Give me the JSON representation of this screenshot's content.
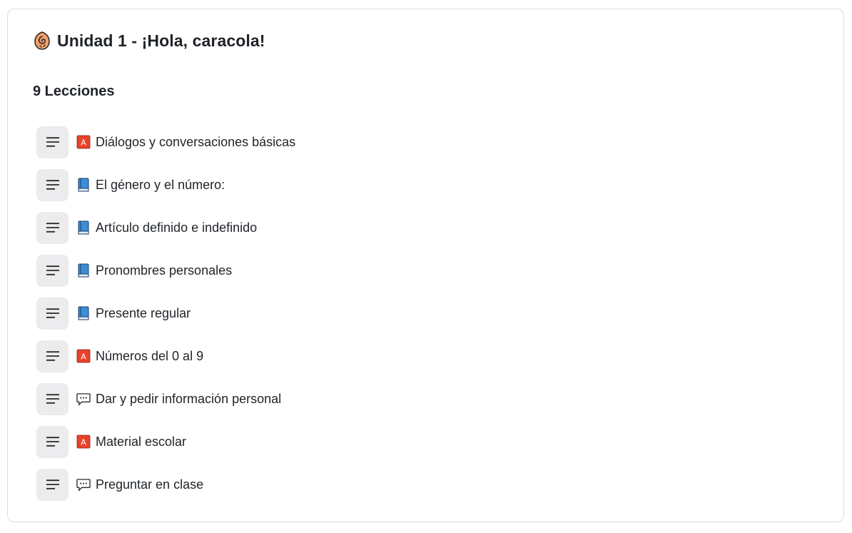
{
  "unit": {
    "icon": "snail-shell-icon",
    "title": "Unidad 1 - ¡Hola, caracola!"
  },
  "lessons_heading": "9 Lecciones",
  "colors": {
    "handle_bg": "#ececee",
    "badge_red": "#e8432a",
    "book_blue": "#3b8ed8",
    "text": "#1f2328"
  },
  "lessons": [
    {
      "icon": "letter-a-badge-icon",
      "title": "Diálogos y conversaciones básicas"
    },
    {
      "icon": "blue-book-icon",
      "title": "El género y el número:"
    },
    {
      "icon": "blue-book-icon",
      "title": "Artículo definido e indefinido"
    },
    {
      "icon": "blue-book-icon",
      "title": "Pronombres personales"
    },
    {
      "icon": "blue-book-icon",
      "title": "Presente regular"
    },
    {
      "icon": "letter-a-badge-icon",
      "title": "Números del 0 al 9"
    },
    {
      "icon": "speech-bubble-icon",
      "title": "Dar y pedir información personal"
    },
    {
      "icon": "letter-a-badge-icon",
      "title": "Material escolar"
    },
    {
      "icon": "speech-bubble-icon",
      "title": "Preguntar en clase"
    }
  ]
}
